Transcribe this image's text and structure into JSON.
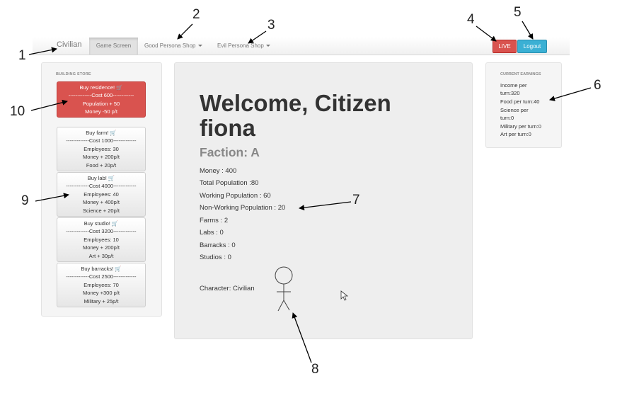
{
  "navbar": {
    "brand": "Civilian",
    "game_screen": "Game Screen",
    "good_shop": "Good Persona Shop",
    "evil_shop": "Evil Persona Shop",
    "live": "LIVE",
    "logout": "Logout"
  },
  "store": {
    "title": "BUILDING STORE",
    "items": [
      {
        "buy": "Buy residence! 🛒",
        "cost": "-------------Cost 600------------",
        "l1": "Population + 50",
        "l2": "Money -50 p/t"
      },
      {
        "buy": "Buy farm! 🛒",
        "cost": "-------------Cost 1000-------------",
        "l1": "Employees: 30",
        "l2": "Money + 200p/t",
        "l3": "Food + 20p/t"
      },
      {
        "buy": "Buy lab! 🛒",
        "cost": "-------------Cost 4000-------------",
        "l1": "Employees: 40",
        "l2": "Money + 400p/t",
        "l3": "Science + 20p/t"
      },
      {
        "buy": "Buy studio! 🛒",
        "cost": "-------------Cost 3200-------------",
        "l1": "Employees: 10",
        "l2": "Money + 200p/t",
        "l3": "Art + 30p/t"
      },
      {
        "buy": "Buy barracks! 🛒",
        "cost": "-------------Cost 2500-------------",
        "l1": "Employees: 70",
        "l2": "Money +300 p/t",
        "l3": "Military + 25p/t"
      }
    ]
  },
  "main": {
    "welcome": "Welcome, Citizen fiona",
    "faction": "Faction: A",
    "stats": [
      "Money : 400",
      "Total Population :80",
      "Working Population : 60",
      "Non-Working Population : 20",
      "Farms : 2",
      "Labs : 0",
      "Barracks : 0",
      "Studios : 0"
    ],
    "character": "Character: Civilian"
  },
  "earnings": {
    "title": "CURRENT EARNINGS",
    "lines": [
      "Income per",
      "turn:320",
      "Food per turn:40",
      "Science per",
      "turn:0",
      "Military per turn:0",
      "Art per turn:0"
    ]
  },
  "callouts": [
    "1",
    "2",
    "3",
    "4",
    "5",
    "6",
    "7",
    "8",
    "9",
    "10"
  ],
  "colors": {
    "danger": "#d9534f",
    "info": "#3bb0d4",
    "well": "#f5f5f5",
    "main": "#eeeeee"
  }
}
